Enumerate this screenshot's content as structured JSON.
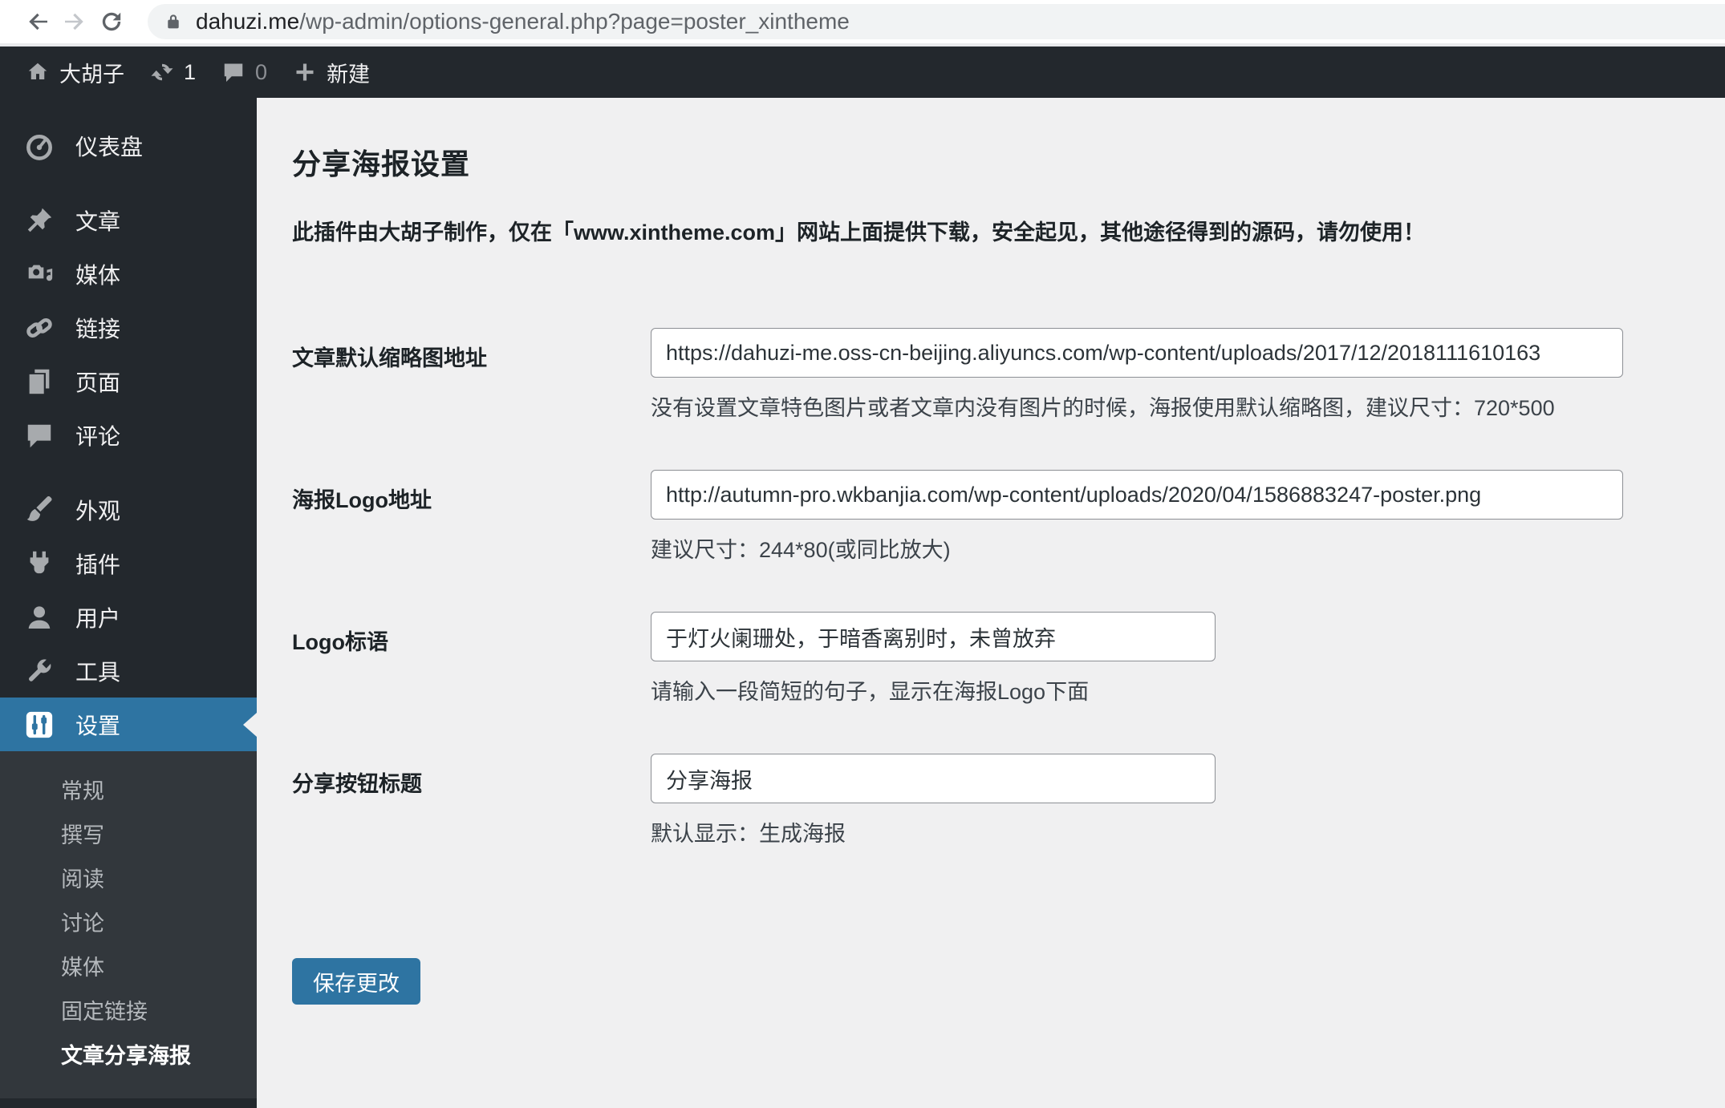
{
  "browser": {
    "url_host": "dahuzi.me",
    "url_path": "/wp-admin/options-general.php?page=poster_xintheme"
  },
  "admin_bar": {
    "site_name": "大胡子",
    "updates_count": "1",
    "comments_count": "0",
    "new_label": "新建"
  },
  "sidebar": {
    "items": [
      {
        "label": "仪表盘",
        "icon": "dashboard-icon"
      },
      {
        "label": "文章",
        "icon": "posts-pin-icon"
      },
      {
        "label": "媒体",
        "icon": "media-icon"
      },
      {
        "label": "链接",
        "icon": "links-icon"
      },
      {
        "label": "页面",
        "icon": "pages-icon"
      },
      {
        "label": "评论",
        "icon": "comments-icon"
      },
      {
        "label": "外观",
        "icon": "appearance-icon"
      },
      {
        "label": "插件",
        "icon": "plugins-icon"
      },
      {
        "label": "用户",
        "icon": "users-icon"
      },
      {
        "label": "工具",
        "icon": "tools-icon"
      },
      {
        "label": "设置",
        "icon": "settings-icon"
      }
    ],
    "submenu": {
      "items": [
        {
          "label": "常规"
        },
        {
          "label": "撰写"
        },
        {
          "label": "阅读"
        },
        {
          "label": "讨论"
        },
        {
          "label": "媒体"
        },
        {
          "label": "固定链接"
        },
        {
          "label": "文章分享海报"
        }
      ],
      "active": "文章分享海报"
    }
  },
  "main": {
    "title": "分享海报设置",
    "notice": "此插件由大胡子制作，仅在「www.xintheme.com」网站上面提供下载，安全起见，其他途径得到的源码，请勿使用！",
    "fields": [
      {
        "label": "文章默认缩略图地址",
        "value": "https://dahuzi-me.oss-cn-beijing.aliyuncs.com/wp-content/uploads/2017/12/2018111610163",
        "help": "没有设置文章特色图片或者文章内没有图片的时候，海报使用默认缩略图，建议尺寸：720*500"
      },
      {
        "label": "海报Logo地址",
        "value": "http://autumn-pro.wkbanjia.com/wp-content/uploads/2020/04/1586883247-poster.png",
        "help": "建议尺寸：244*80(或同比放大)"
      },
      {
        "label": "Logo标语",
        "value": "于灯火阑珊处，于暗香离别时，未曾放弃",
        "help": "请输入一段简短的句子，显示在海报Logo下面"
      },
      {
        "label": "分享按钮标题",
        "value": "分享海报",
        "help": "默认显示：生成海报"
      }
    ],
    "save_label": "保存更改"
  },
  "colors": {
    "accent_blue": "#2e74a2",
    "admin_dark": "#23282d",
    "submenu_dark": "#32373c",
    "content_bg": "#f0f0f1",
    "icon_gray": "#a7aaad"
  }
}
